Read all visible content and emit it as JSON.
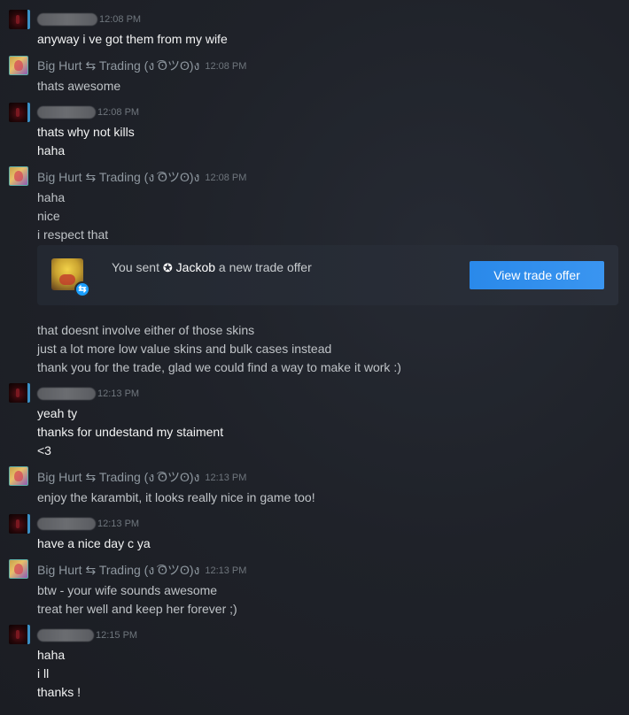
{
  "my_name": "Big Hurt ⇆ Trading (ง ͡ʘツʘ)ง",
  "trade_card": {
    "prefix": "You sent ",
    "friend_glyph": "✪",
    "friend_name": " Jackob",
    "suffix": " a new trade offer",
    "button_label": "View trade offer",
    "badge_glyph": "⇆"
  },
  "messages": [
    {
      "sender": "other",
      "time": "12:08 PM",
      "lines": [
        "anyway i ve got them from my wife"
      ]
    },
    {
      "sender": "me",
      "time": "12:08 PM",
      "lines": [
        "thats awesome"
      ]
    },
    {
      "sender": "other",
      "time": "12:08 PM",
      "lines": [
        "thats why not kills",
        "haha"
      ]
    },
    {
      "sender": "me",
      "time": "12:08 PM",
      "lines": [
        "haha",
        "nice",
        "i respect that"
      ]
    },
    {
      "sender": "me-continued",
      "lines": [
        "that doesnt involve either of those skins",
        "just a lot more low value skins and bulk cases instead",
        "thank you for the trade, glad we could find a way to make it work :)"
      ]
    },
    {
      "sender": "other",
      "time": "12:13 PM",
      "lines": [
        "yeah ty",
        "thanks for undestand my staiment",
        "<3"
      ]
    },
    {
      "sender": "me",
      "time": "12:13 PM",
      "lines": [
        "enjoy the karambit, it looks really nice in game too!"
      ]
    },
    {
      "sender": "other",
      "time": "12:13 PM",
      "lines": [
        "have a nice day c ya"
      ]
    },
    {
      "sender": "me",
      "time": "12:13 PM",
      "lines": [
        "btw - your wife sounds awesome",
        "treat her well and keep her forever ;)"
      ]
    },
    {
      "sender": "other",
      "time": "12:15 PM",
      "lines": [
        "haha",
        "i ll",
        "thanks !"
      ]
    }
  ]
}
